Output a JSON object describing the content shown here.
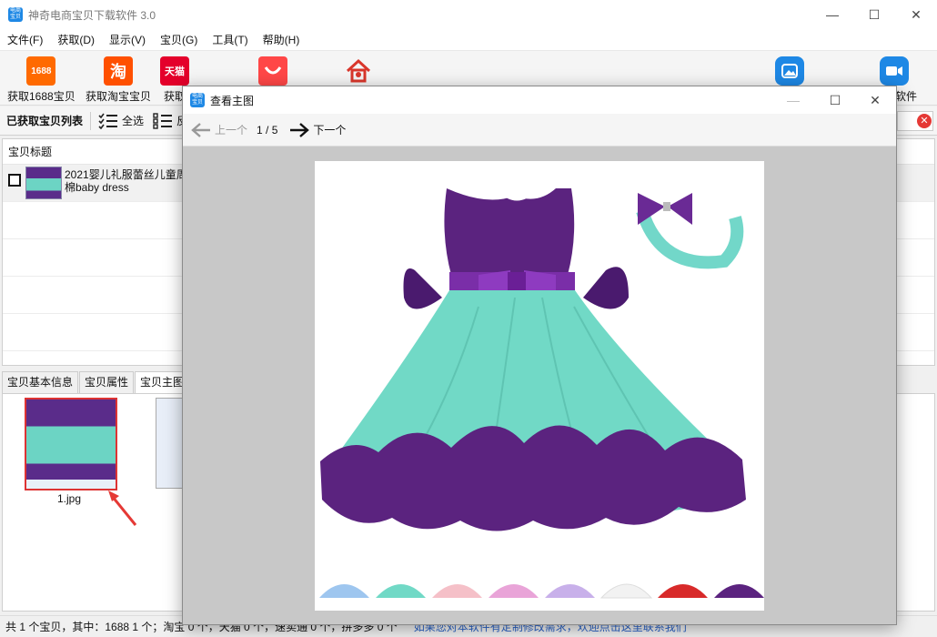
{
  "app": {
    "title": "神奇电商宝贝下载软件 3.0",
    "icon_text": "电商宝贝"
  },
  "window_controls": {
    "minimize": "—",
    "maximize": "☐",
    "close": "✕"
  },
  "menu": [
    "文件(F)",
    "获取(D)",
    "显示(V)",
    "宝贝(G)",
    "工具(T)",
    "帮助(H)"
  ],
  "toolbar": {
    "items": [
      {
        "label": "获取1688宝贝",
        "icon": "1688-icon",
        "icon_text": "1688",
        "color": "#ff6a00"
      },
      {
        "label": "获取淘宝宝贝",
        "icon": "taobao-icon",
        "icon_text": "淘",
        "color": "#ff5000"
      },
      {
        "label": "获取",
        "icon": "tmall-icon",
        "icon_text": "天猫",
        "color": "#e4002b"
      },
      {
        "label": "",
        "icon": "aliexpress-icon",
        "icon_text": "",
        "color": "#ff4747"
      },
      {
        "label": "",
        "icon": "home-icon",
        "icon_text": "",
        "color": "#d9362b"
      },
      {
        "label": "",
        "icon": "image-icon",
        "icon_text": "",
        "color": "#1e88e5"
      },
      {
        "label": "理软件",
        "icon": "video-icon",
        "icon_text": "",
        "color": "#1e88e5"
      }
    ]
  },
  "listbar": {
    "title": "已获取宝贝列表",
    "select_all": "全选",
    "invert": "反"
  },
  "table": {
    "header": "宝贝标题",
    "rows": [
      {
        "title_line1": "2021婴儿礼服蕾丝儿童周",
        "title_line2": "棉baby dress"
      }
    ]
  },
  "tabs": [
    "宝贝基本信息",
    "宝贝属性",
    "宝贝主图"
  ],
  "images": {
    "first_name": "1.jpg"
  },
  "status": {
    "text": "共 1 个宝贝，其中：1688 1 个；淘宝 0 个，天猫 0 个，速卖通 0 个，拼多多 0 个",
    "link": "如果您对本软件有定制修改需求，欢迎点击这里联系我们"
  },
  "dialog": {
    "title": "查看主图",
    "prev": "上一个",
    "counter": "1 / 5",
    "next": "下一个"
  },
  "colors": {
    "dress_purple": "#5b237f",
    "dress_teal": "#71d9c6",
    "close_red": "#e53935",
    "link_blue": "#2962c7"
  }
}
